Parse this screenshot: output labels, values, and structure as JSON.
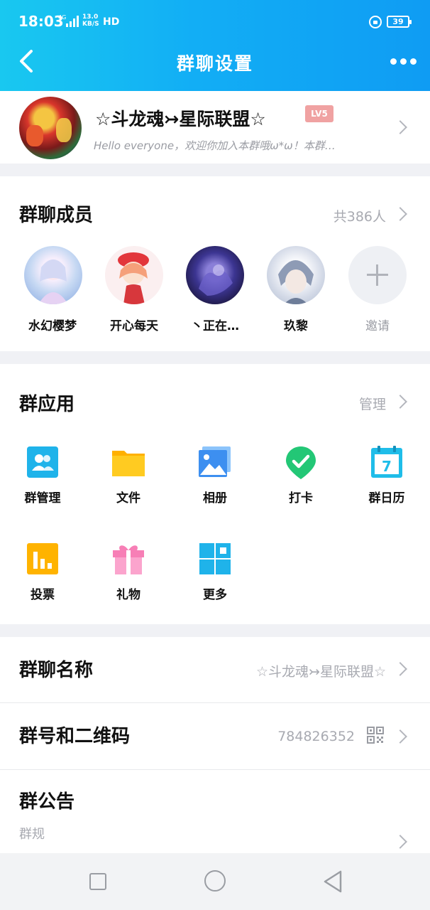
{
  "status_bar": {
    "time": "18:03",
    "network": "4G",
    "speed_value": "13.0",
    "speed_unit": "KB/S",
    "hd": "HD",
    "battery": "39"
  },
  "nav": {
    "title": "群聊设置",
    "back_icon": "back-arrow-icon",
    "more_icon": "more-dots-icon"
  },
  "group": {
    "name": "☆斗龙魂↣星际联盟☆",
    "level": "LV5",
    "description": "Hello everyone，欢迎你加入本群哦ω*ω！本群…"
  },
  "members": {
    "title": "群聊成员",
    "count": "共386人",
    "items": [
      {
        "name": "水幻樱梦"
      },
      {
        "name": "开心每天"
      },
      {
        "name": "丶正在…"
      },
      {
        "name": "玖黎"
      }
    ],
    "invite_label": "邀请"
  },
  "apps": {
    "title": "群应用",
    "manage": "管理",
    "items": [
      {
        "label": "群管理",
        "icon": "group-manage-icon",
        "color": "#1fb3ea"
      },
      {
        "label": "文件",
        "icon": "folder-icon",
        "color": "#ffc107"
      },
      {
        "label": "相册",
        "icon": "photo-album-icon",
        "color": "#3d8ff0"
      },
      {
        "label": "打卡",
        "icon": "check-in-icon",
        "color": "#23c776"
      },
      {
        "label": "群日历",
        "icon": "calendar-icon",
        "color": "#1fbde9"
      },
      {
        "label": "投票",
        "icon": "vote-icon",
        "color": "#ffb300"
      },
      {
        "label": "礼物",
        "icon": "gift-icon",
        "color": "#f77fb6"
      },
      {
        "label": "更多",
        "icon": "more-apps-icon",
        "color": "#1fb3ea"
      }
    ]
  },
  "rows": {
    "group_name_title": "群聊名称",
    "group_name_value": "☆斗龙魂↣星际联盟☆",
    "group_id_title": "群号和二维码",
    "group_id_value": "784826352",
    "notice_title": "群公告",
    "notice_value": "群规"
  },
  "colors": {
    "header_start": "#19c8f0",
    "header_end": "#0f9cf3",
    "badge": "#f0a2a2"
  }
}
